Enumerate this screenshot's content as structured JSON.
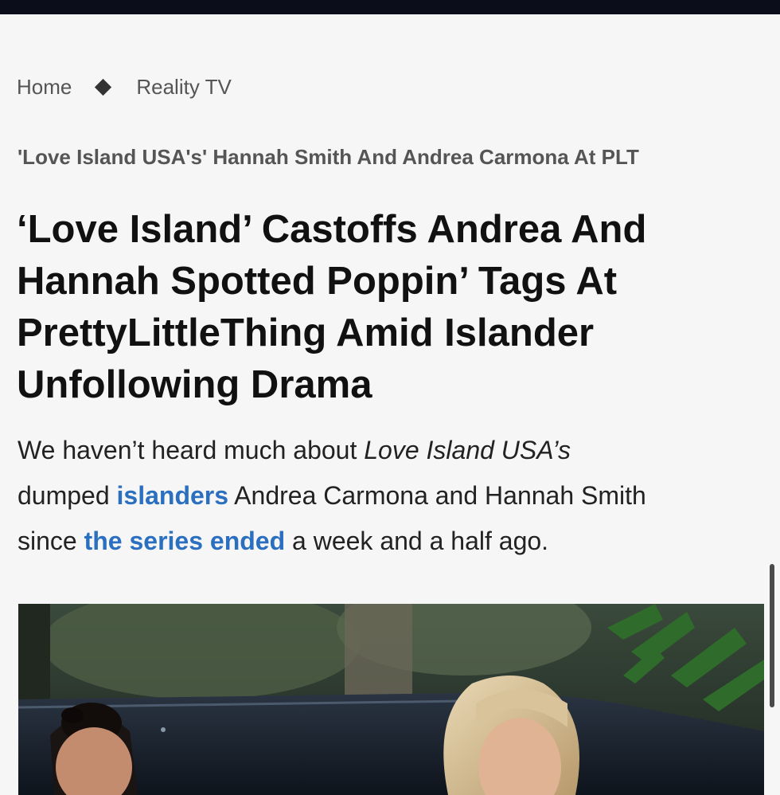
{
  "breadcrumb": {
    "home_label": "Home",
    "section_label": "Reality TV",
    "separator_icon": "diamond-icon"
  },
  "article": {
    "kicker": "'Love Island USA's' Hannah Smith And Andrea Carmona At PLT",
    "headline_lines": [
      "‘Love Island’ Castoffs Andrea And",
      "Hannah Spotted Poppin’ Tags At",
      "PrettyLittleThing Amid Islander",
      "Unfollowing Drama"
    ],
    "dek": {
      "line1_text": "We haven’t heard much about ",
      "line1_italic": "Love Island USA’s",
      "line2_before": "dumped ",
      "line2_link": "islanders",
      "line2_after": " Andrea Carmona and Hannah Smith",
      "line3_before": "since ",
      "line3_link": "the series ended",
      "line3_after": " a week and a half ago."
    },
    "link_color": "#2a6fc0"
  },
  "photo": {
    "icon": "article-photo"
  }
}
